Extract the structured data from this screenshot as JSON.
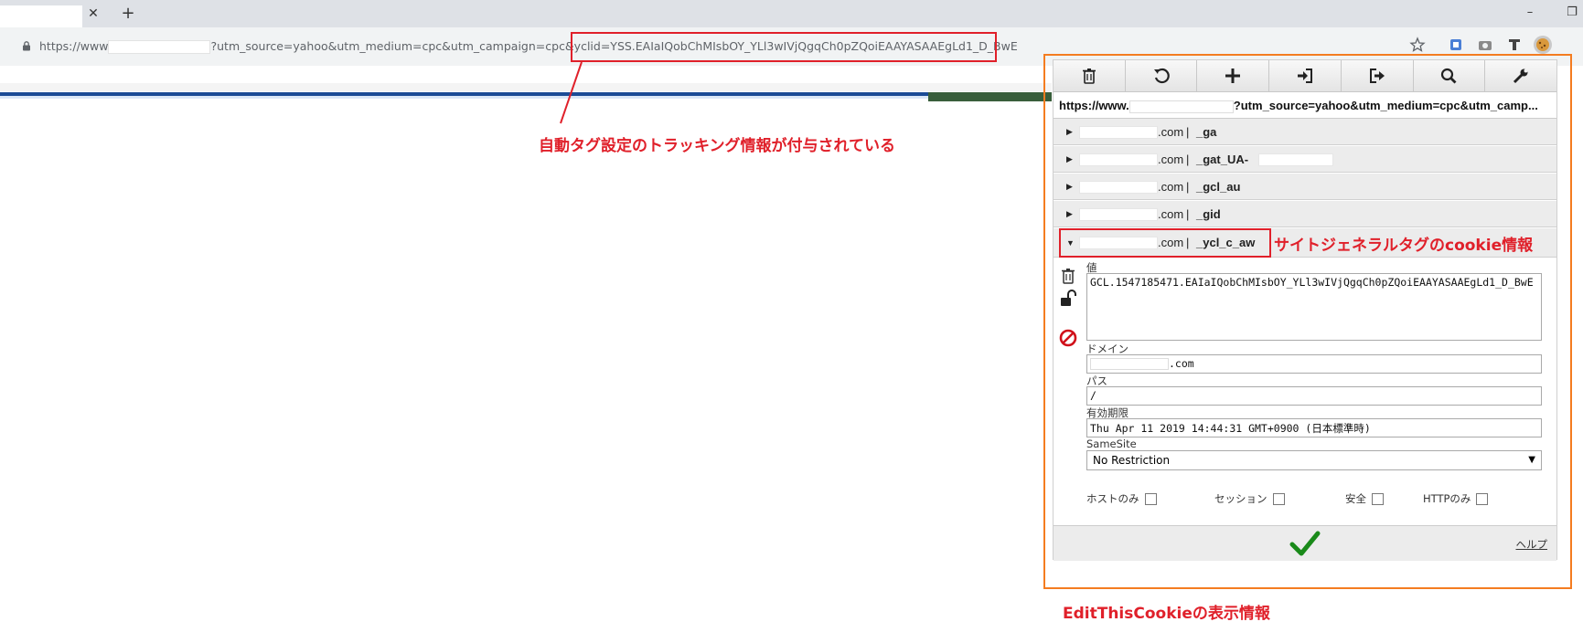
{
  "browser": {
    "new_tab_label": "+",
    "close_tab_glyph": "✕",
    "minimize_glyph": "–",
    "restore_glyph": "❐",
    "url_prefix": "https://www",
    "url_suffix": "?utm_source=yahoo&utm_medium=cpc&utm_campaign=cpc&yclid=YSS.EAIaIQobChMIsbOY_YLl3wIVjQgqCh0pZQoiEAAYASAAEgLd1_D_BwE"
  },
  "annotations": {
    "url_note": "自動タグ設定のトラッキング情報が付与されている",
    "cookie_note": "サイトジェネラルタグのcookie情報",
    "panel_note": "EditThisCookieの表示情報"
  },
  "popup": {
    "toolbar_icons": [
      "trash-icon",
      "reset-icon",
      "add-icon",
      "import-icon",
      "export-icon",
      "search-icon",
      "settings-icon"
    ],
    "current_url_prefix": "https://www.",
    "current_url_suffix": "?utm_source=yahoo&utm_medium=cpc&utm_camp...",
    "cookies": [
      {
        "domain": ".com",
        "sep": "|",
        "name": "_ga"
      },
      {
        "domain": ".com",
        "sep": "|",
        "name": "_gat_UA-"
      },
      {
        "domain": ".com",
        "sep": "|",
        "name": "_gcl_au"
      },
      {
        "domain": ".com",
        "sep": "|",
        "name": "_gid"
      },
      {
        "domain": ".com",
        "sep": "|",
        "name": "_ycl_c_aw"
      }
    ],
    "detail": {
      "value_label": "値",
      "value": "GCL.1547185471.EAIaIQobChMIsbOY_YLl3wIVjQgqCh0pZQoiEAAYASAAEgLd1_D_BwE",
      "domain_label": "ドメイン",
      "domain_value": ".com",
      "path_label": "パス",
      "path_value": "/",
      "expires_label": "有効期限",
      "expires_value": "Thu Apr 11 2019 14:44:31 GMT+0900 (日本標準時)",
      "samesite_label": "SameSite",
      "samesite_value": "No Restriction",
      "checkboxes": [
        "ホストのみ",
        "セッション",
        "安全",
        "HTTPのみ"
      ]
    },
    "help_label": "ヘルプ"
  },
  "colors": {
    "annotation_red": "#e0202a",
    "frame_orange": "#f47c20",
    "confirm_green": "#1a8a1a"
  }
}
